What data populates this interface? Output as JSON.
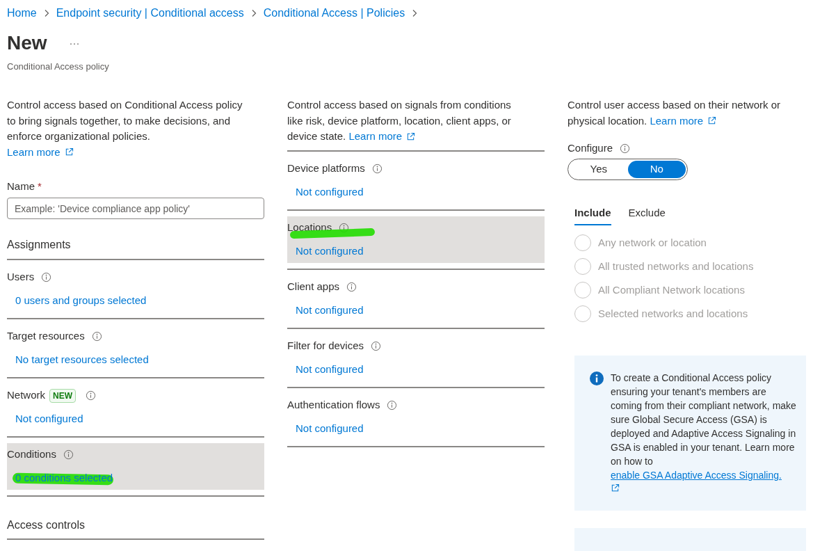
{
  "breadcrumb": [
    {
      "label": "Home"
    },
    {
      "label": "Endpoint security | Conditional access"
    },
    {
      "label": "Conditional Access | Policies"
    }
  ],
  "page": {
    "title": "New",
    "more": "···",
    "subtitle": "Conditional Access policy"
  },
  "left": {
    "description": "Control access based on Conditional Access policy to bring signals together, to make decisions, and enforce organizational policies.",
    "learn_more": "Learn more",
    "name_field": {
      "label": "Name",
      "required": "*",
      "placeholder": "Example: 'Device compliance app policy'"
    },
    "assignments": {
      "heading": "Assignments",
      "items": [
        {
          "label": "Users",
          "value": "0 users and groups selected",
          "selected": false,
          "label_marked": false,
          "value_marked": false
        },
        {
          "label": "Target resources",
          "value": "No target resources selected",
          "selected": false,
          "label_marked": false,
          "value_marked": false
        },
        {
          "label": "Network",
          "badge": "NEW",
          "value": "Not configured",
          "selected": false,
          "label_marked": false,
          "value_marked": false
        },
        {
          "label": "Conditions",
          "value": "0 conditions selected",
          "selected": true,
          "label_marked": false,
          "value_marked": true
        }
      ]
    },
    "access_controls": {
      "heading": "Access controls"
    }
  },
  "middle": {
    "description": "Control access based on signals from conditions like risk, device platform, location, client apps, or device state.",
    "learn_more": "Learn more",
    "items": [
      {
        "label": "Device platforms",
        "value": "Not configured",
        "selected": false,
        "label_marked": false,
        "value_marked": false
      },
      {
        "label": "Locations",
        "value": "Not configured",
        "selected": true,
        "label_marked": true,
        "value_marked": false
      },
      {
        "label": "Client apps",
        "value": "Not configured",
        "selected": false,
        "label_marked": false,
        "value_marked": false
      },
      {
        "label": "Filter for devices",
        "value": "Not configured",
        "selected": false,
        "label_marked": false,
        "value_marked": false
      },
      {
        "label": "Authentication flows",
        "value": "Not configured",
        "selected": false,
        "label_marked": false,
        "value_marked": false
      }
    ]
  },
  "right": {
    "description": "Control user access based on their network or physical location.",
    "learn_more": "Learn more",
    "configure": {
      "label": "Configure",
      "options": [
        {
          "label": "Yes",
          "selected": false
        },
        {
          "label": "No",
          "selected": true
        }
      ]
    },
    "tabs": [
      {
        "label": "Include",
        "selected": true
      },
      {
        "label": "Exclude",
        "selected": false
      }
    ],
    "radios": [
      {
        "label": "Any network or location",
        "checked": false,
        "disabled": true
      },
      {
        "label": "All trusted networks and locations",
        "checked": false,
        "disabled": true
      },
      {
        "label": "All Compliant Network locations",
        "checked": false,
        "disabled": true
      },
      {
        "label": "Selected networks and locations",
        "checked": false,
        "disabled": true
      }
    ],
    "info": {
      "text": "To create a Conditional Access policy ensuring your tenant's members are coming from their compliant network, make sure Global Secure Access (GSA) is deployed and Adaptive Access Signaling in GSA is enabled in your tenant. Learn more on how to",
      "link": "enable GSA Adaptive Access Signaling."
    }
  }
}
